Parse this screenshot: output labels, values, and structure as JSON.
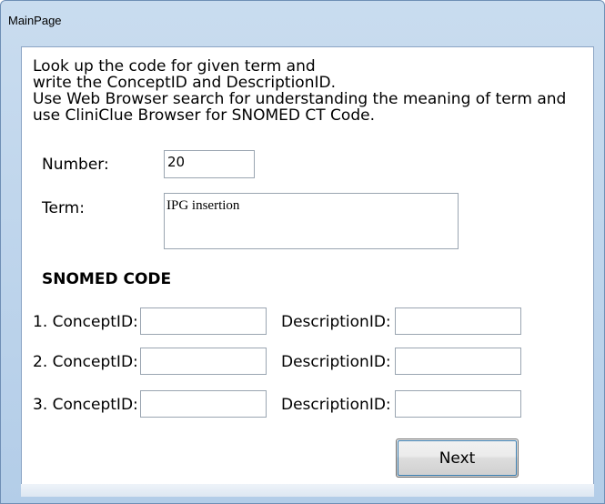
{
  "window": {
    "title": "MainPage"
  },
  "instructions": [
    "Look up the code for given term and",
    "write the ConceptID and DescriptionID.",
    "Use Web Browser search for understanding the meaning of term and",
    "use CliniClue Browser for SNOMED CT Code."
  ],
  "number": {
    "label": "Number:",
    "value": "20"
  },
  "term": {
    "label": "Term:",
    "value": "IPG insertion"
  },
  "snomed": {
    "heading": "SNOMED CODE",
    "rows": [
      {
        "concept_label": "1. ConceptID:",
        "concept_value": "",
        "description_label": "DescriptionID:",
        "description_value": ""
      },
      {
        "concept_label": "2. ConceptID:",
        "concept_value": "",
        "description_label": "DescriptionID:",
        "description_value": ""
      },
      {
        "concept_label": "3. ConceptID:",
        "concept_value": "",
        "description_label": "DescriptionID:",
        "description_value": ""
      }
    ]
  },
  "next_button": {
    "label": "Next"
  },
  "colors": {
    "titlebar": "#b3cde8",
    "focus_border": "#3c7fb1",
    "field_border": "#9aa5b1"
  }
}
